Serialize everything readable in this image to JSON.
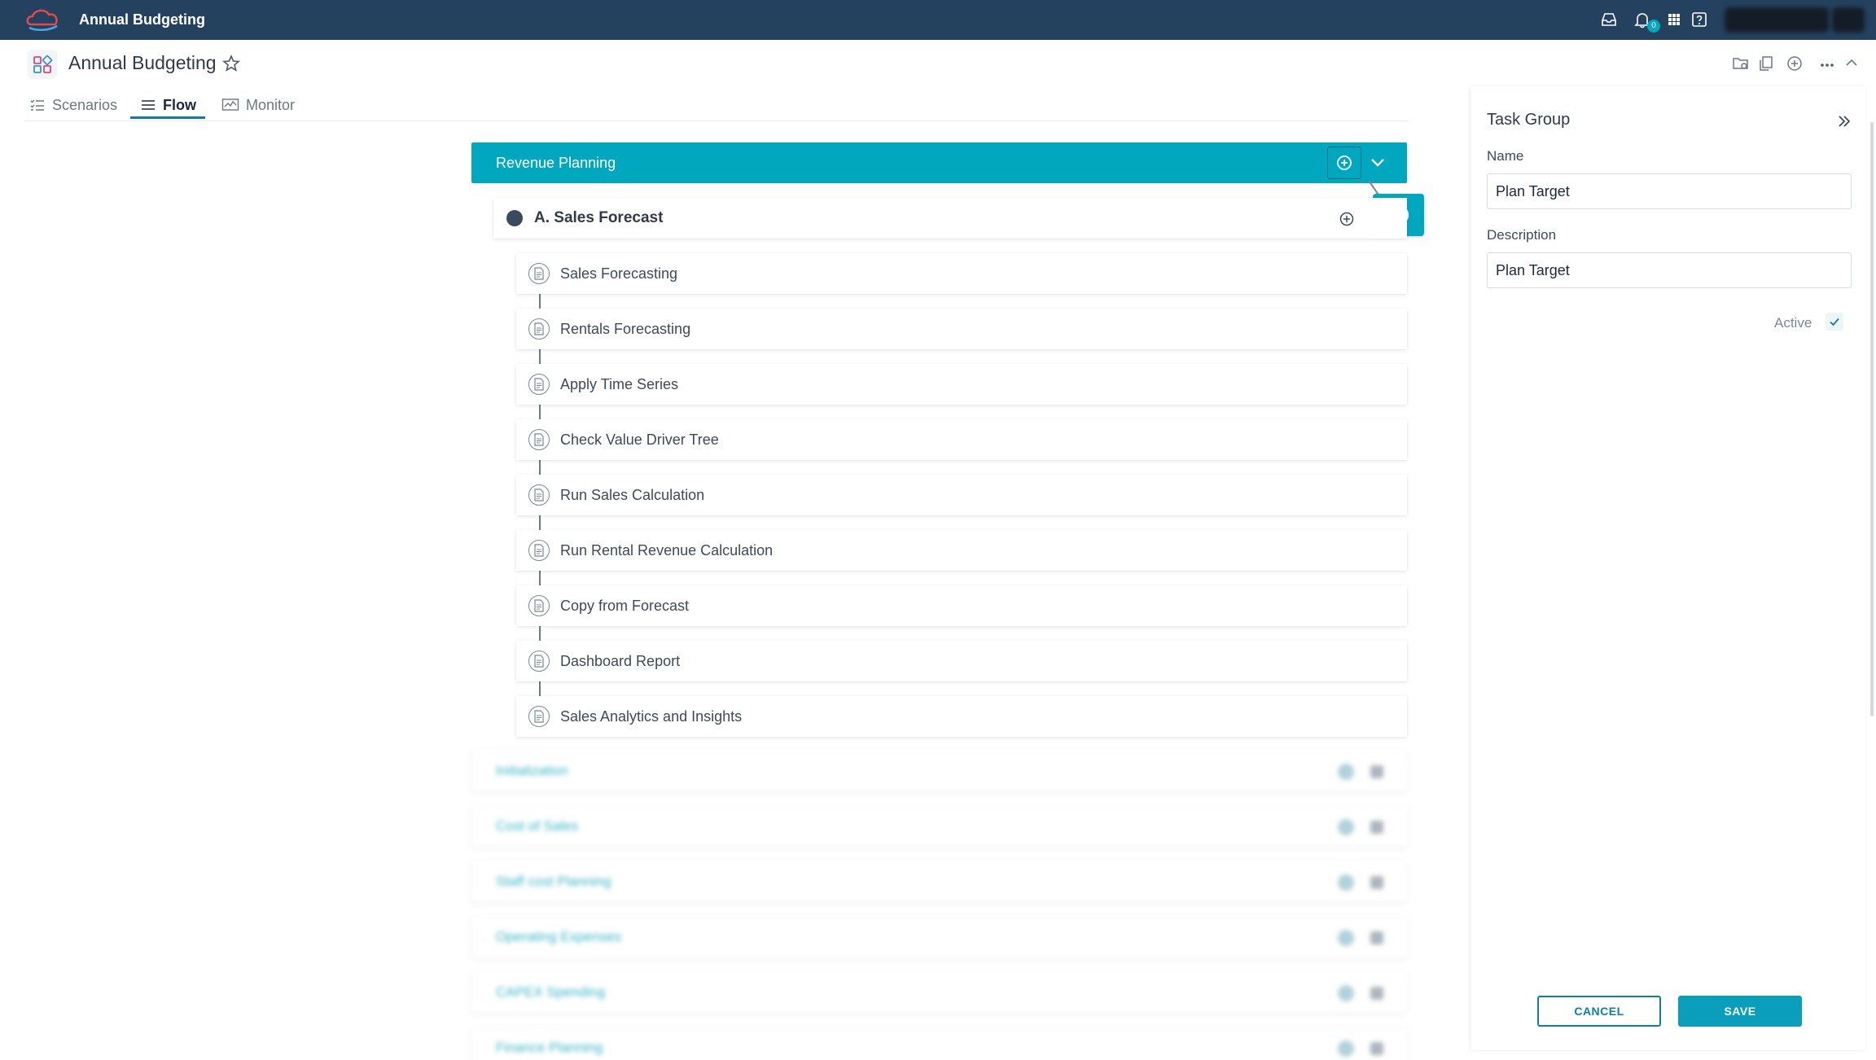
{
  "topbar": {
    "app_name": "Annual Budgeting",
    "notification_count": "0",
    "icons": [
      "logo-icon",
      "inbox-icon",
      "bell-icon",
      "apps-grid-icon",
      "help-icon"
    ]
  },
  "header": {
    "title": "Annual Budgeting",
    "icons": [
      "page-app-icon",
      "star-icon",
      "settings-folder-icon",
      "copy-icon",
      "add-circle-icon",
      "more-icon",
      "chevron-up-icon"
    ]
  },
  "tabs": [
    {
      "label": "Scenarios",
      "icon": "list-icon"
    },
    {
      "label": "Flow",
      "icon": "menu-icon",
      "active": true
    },
    {
      "label": "Monitor",
      "icon": "chart-icon"
    }
  ],
  "flow": {
    "group_title": "Revenue Planning",
    "subgroup_title": "A. Sales Forecast",
    "tasks": [
      "Sales Forecasting",
      "Rentals Forecasting",
      "Apply Time Series",
      "Check Value Driver Tree",
      "Run Sales Calculation",
      "Run Rental Revenue Calculation",
      "Copy from Forecast",
      "Dashboard Report",
      "Sales Analytics and Insights"
    ],
    "blurred_groups": [
      "Initialization",
      "Cost of Sales",
      "Staff cost Planning",
      "Operating Expenses",
      "CAPEX Spending",
      "Finance Planning"
    ]
  },
  "panel": {
    "title": "Task Group",
    "name_label": "Name",
    "name_value": "Plan Target",
    "description_label": "Description",
    "description_value": "Plan Target",
    "active_label": "Active",
    "active_checked": true,
    "cancel_label": "CANCEL",
    "save_label": "SAVE"
  },
  "colors": {
    "topbar": "#24425f",
    "accent": "#00a7bf",
    "button_primary": "#0a9dbc"
  }
}
